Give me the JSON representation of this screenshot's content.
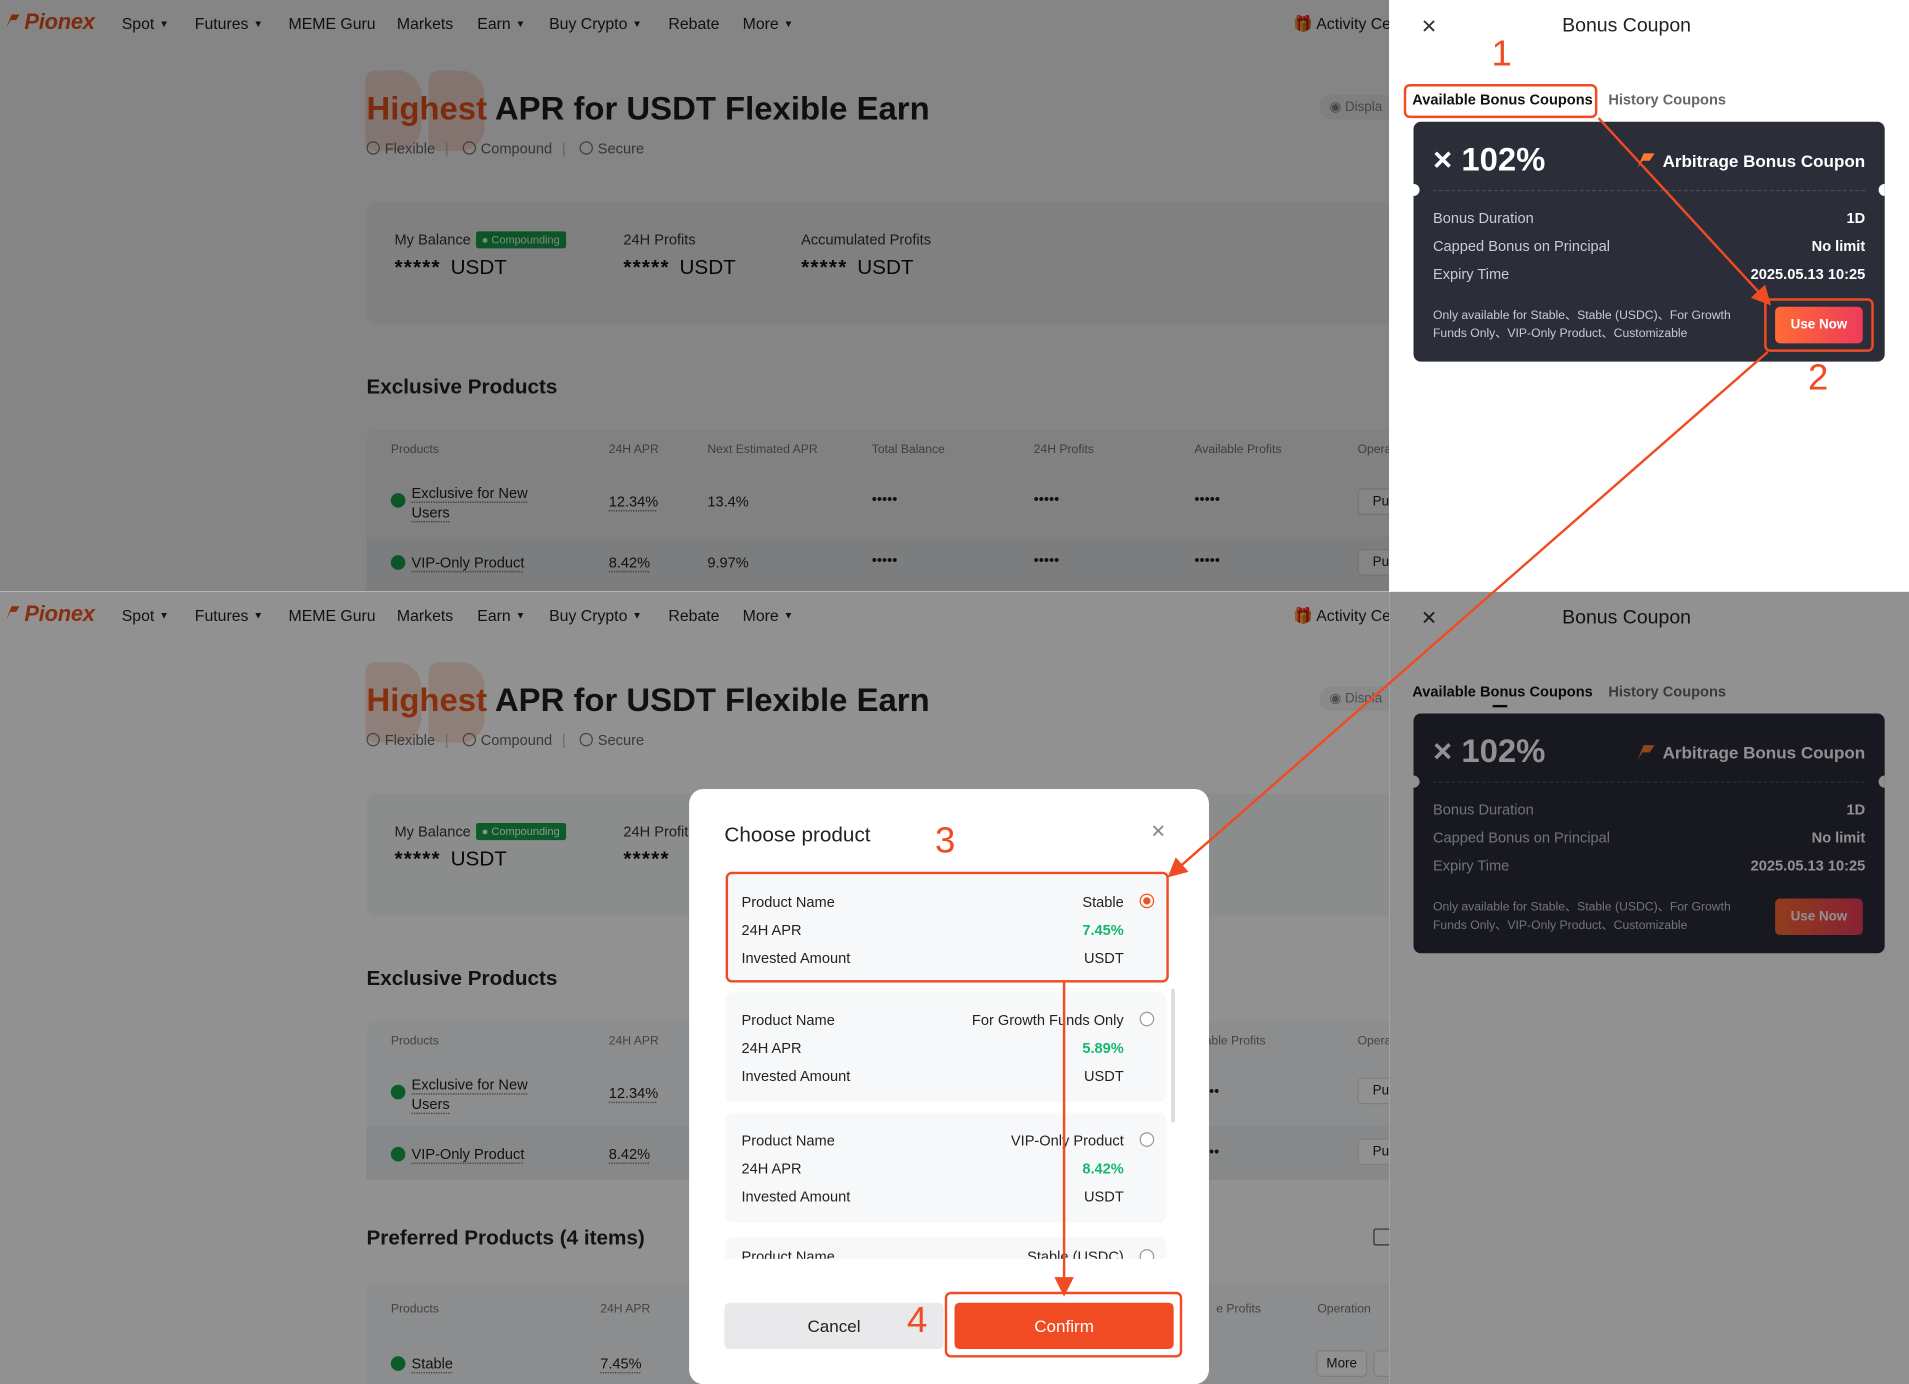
{
  "nav": {
    "logo": "Pionex",
    "items": [
      {
        "label": "Spot",
        "caret": true
      },
      {
        "label": "Futures",
        "caret": true
      },
      {
        "label": "MEME Guru",
        "caret": false
      },
      {
        "label": "Markets",
        "caret": false
      },
      {
        "label": "Earn",
        "caret": true
      },
      {
        "label": "Buy Crypto",
        "caret": true
      },
      {
        "label": "Rebate",
        "caret": false
      },
      {
        "label": "More",
        "caret": true
      }
    ],
    "activity": "Activity Ce"
  },
  "hero": {
    "title_highlight": "Highest",
    "title_rest": " APR for USDT Flexible Earn",
    "features": [
      "Flexible",
      "Compound",
      "Secure"
    ],
    "display_hint": "Displa"
  },
  "balance": {
    "my_balance_label": "My Balance",
    "compounding_badge": "Compounding",
    "profits_24h_label": "24H Profits",
    "accumulated_label": "Accumulated Profits",
    "masked": "*****",
    "currency": "USDT"
  },
  "exclusive": {
    "title": "Exclusive Products",
    "columns": [
      "Products",
      "24H APR",
      "Next Estimated APR",
      "Total Balance",
      "24H Profits",
      "Available Profits",
      "Opera"
    ],
    "rows": [
      {
        "name": "Exclusive for New Users",
        "apr": "12.34%",
        "next_apr": "13.4%",
        "total": "•••••",
        "profits": "•••••",
        "available": "•••••",
        "op": "Pur"
      },
      {
        "name": "VIP-Only Product",
        "apr": "8.42%",
        "next_apr": "9.97%",
        "total": "•••••",
        "profits": "•••••",
        "available": "•••••",
        "op": "Pur"
      }
    ],
    "bottom_partial_profits_header": "ilable Profits",
    "bottom_partial_dots": "••",
    "bottom_partial_op": "Pur"
  },
  "preferred": {
    "title": "Preferred Products (4 items)",
    "columns": [
      "Products",
      "24H APR",
      "e Profits",
      "Operation"
    ],
    "first_row": {
      "name": "Stable",
      "apr": "7.45%",
      "op": "More",
      "op2": "P"
    }
  },
  "drawer": {
    "title": "Bonus Coupon",
    "tab_available": "Available Bonus Coupons",
    "tab_history": "History Coupons",
    "coupon": {
      "rate": "× 102%",
      "name": "Arbitrage Bonus Coupon",
      "rows": [
        {
          "label": "Bonus Duration",
          "value": "1D"
        },
        {
          "label": "Capped Bonus on Principal",
          "value": "No limit"
        },
        {
          "label": "Expiry Time",
          "value": "2025.05.13 10:25"
        }
      ],
      "note": "Only available for Stable、Stable (USDC)、For Growth Funds Only、VIP-Only Product、Customizable",
      "use_button": "Use Now"
    }
  },
  "modal": {
    "title": "Choose product",
    "labels": {
      "product_name": "Product Name",
      "apr": "24H APR",
      "invested": "Invested Amount"
    },
    "products": [
      {
        "name": "Stable",
        "apr": "7.45%",
        "invested": "USDT",
        "selected": true
      },
      {
        "name": "For Growth Funds Only",
        "apr": "5.89%",
        "invested": "USDT",
        "selected": false
      },
      {
        "name": "VIP-Only Product",
        "apr": "8.42%",
        "invested": "USDT",
        "selected": false
      },
      {
        "name": "Stable (USDC)",
        "apr": "",
        "invested": "",
        "selected": false
      }
    ],
    "cancel": "Cancel",
    "confirm": "Confirm"
  },
  "annotations": {
    "steps": [
      "1",
      "2",
      "3",
      "4"
    ],
    "color": "#f04b22"
  },
  "colors": {
    "brand_orange": "#f0531c",
    "apr_green": "#16b86b",
    "compounding_green": "#16a34a",
    "coupon_bg": "#2b2d39"
  }
}
